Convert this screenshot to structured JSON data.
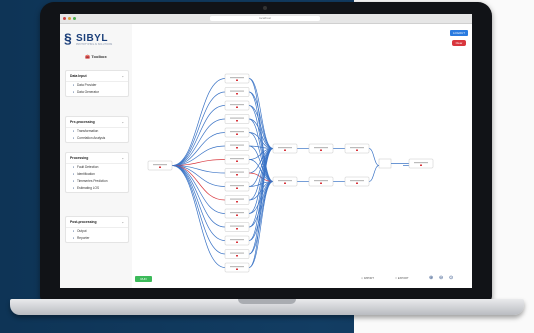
{
  "colors": {
    "accent": "#1b3f7a",
    "edge": "#3b74c6",
    "edge_red": "#d8363d",
    "run": "#3cba5a"
  },
  "app": {
    "name": "SIBYL",
    "subtitle": "PROTOTYPING AI SOLUTIONS",
    "sidebar_title": "Toolbox",
    "url": "localhost"
  },
  "sidebar": {
    "sections": [
      {
        "title": "Data Input",
        "icon": "database-icon",
        "items": [
          {
            "label": "Data Provider",
            "icon": "upload-icon"
          },
          {
            "label": "Data Generator",
            "icon": "generator-icon"
          }
        ]
      },
      {
        "title": "Pre-processing",
        "icon": "",
        "items": [
          {
            "label": "Transformation",
            "icon": "grid-icon"
          },
          {
            "label": "Correlation Analysis",
            "icon": "chart-icon"
          }
        ]
      },
      {
        "title": "Processing",
        "icon": "",
        "items": [
          {
            "label": "Fault Detection",
            "icon": "search-icon"
          },
          {
            "label": "Identification",
            "icon": "fingerprint-icon"
          },
          {
            "label": "Timeseries Prediction",
            "icon": "timeseries-icon"
          },
          {
            "label": "Estimating LOS",
            "icon": "list-icon"
          }
        ]
      },
      {
        "title": "Post-processing",
        "icon": "",
        "items": [
          {
            "label": "Output",
            "icon": "file-icon"
          },
          {
            "label": "Reporter",
            "icon": "report-icon"
          }
        ]
      }
    ]
  },
  "toolbar": {
    "logout": "LOGOUT",
    "clear": "Clear",
    "run": "RUN",
    "import": "IMPORT",
    "export": "EXPORT"
  },
  "icons": {
    "zoom_in": "zoom-in-icon",
    "zoom_out": "zoom-out-icon",
    "zoom_fit": "zoom-fit-icon"
  }
}
